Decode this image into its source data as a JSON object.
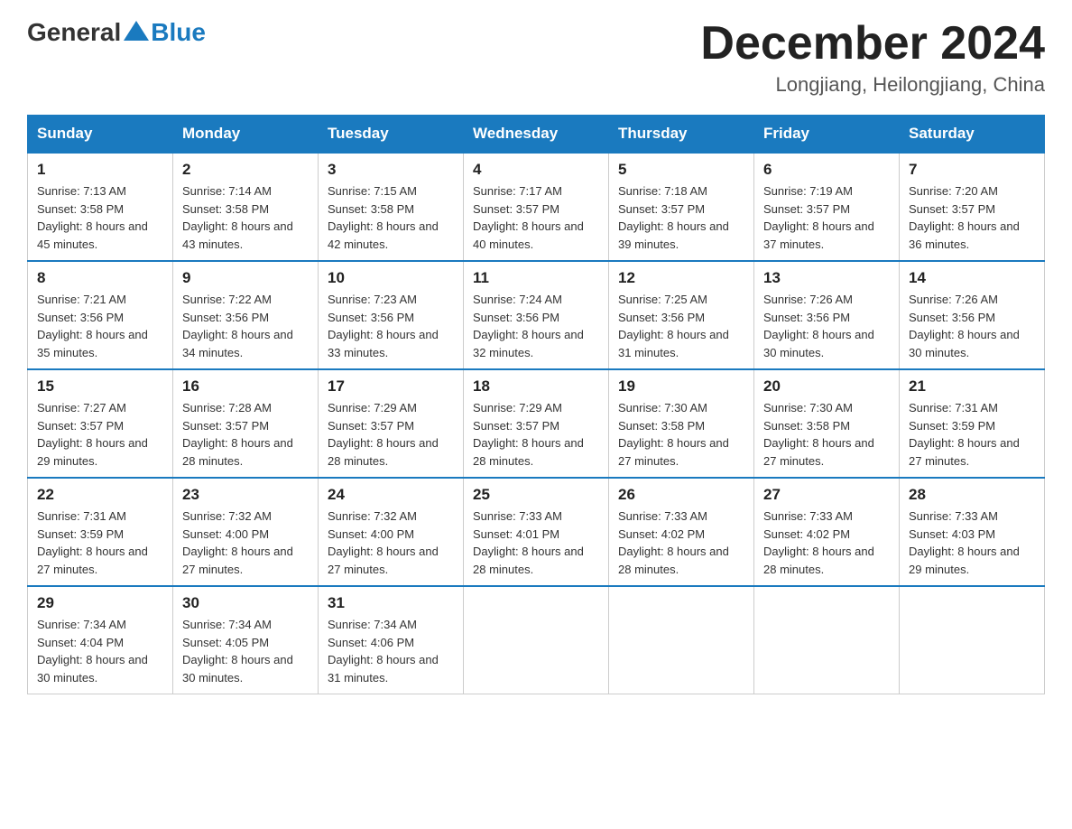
{
  "header": {
    "logo_general": "General",
    "logo_blue": "Blue",
    "month_title": "December 2024",
    "location": "Longjiang, Heilongjiang, China"
  },
  "weekdays": [
    "Sunday",
    "Monday",
    "Tuesday",
    "Wednesday",
    "Thursday",
    "Friday",
    "Saturday"
  ],
  "weeks": [
    [
      {
        "day": "1",
        "sunrise": "7:13 AM",
        "sunset": "3:58 PM",
        "daylight": "8 hours and 45 minutes."
      },
      {
        "day": "2",
        "sunrise": "7:14 AM",
        "sunset": "3:58 PM",
        "daylight": "8 hours and 43 minutes."
      },
      {
        "day": "3",
        "sunrise": "7:15 AM",
        "sunset": "3:58 PM",
        "daylight": "8 hours and 42 minutes."
      },
      {
        "day": "4",
        "sunrise": "7:17 AM",
        "sunset": "3:57 PM",
        "daylight": "8 hours and 40 minutes."
      },
      {
        "day": "5",
        "sunrise": "7:18 AM",
        "sunset": "3:57 PM",
        "daylight": "8 hours and 39 minutes."
      },
      {
        "day": "6",
        "sunrise": "7:19 AM",
        "sunset": "3:57 PM",
        "daylight": "8 hours and 37 minutes."
      },
      {
        "day": "7",
        "sunrise": "7:20 AM",
        "sunset": "3:57 PM",
        "daylight": "8 hours and 36 minutes."
      }
    ],
    [
      {
        "day": "8",
        "sunrise": "7:21 AM",
        "sunset": "3:56 PM",
        "daylight": "8 hours and 35 minutes."
      },
      {
        "day": "9",
        "sunrise": "7:22 AM",
        "sunset": "3:56 PM",
        "daylight": "8 hours and 34 minutes."
      },
      {
        "day": "10",
        "sunrise": "7:23 AM",
        "sunset": "3:56 PM",
        "daylight": "8 hours and 33 minutes."
      },
      {
        "day": "11",
        "sunrise": "7:24 AM",
        "sunset": "3:56 PM",
        "daylight": "8 hours and 32 minutes."
      },
      {
        "day": "12",
        "sunrise": "7:25 AM",
        "sunset": "3:56 PM",
        "daylight": "8 hours and 31 minutes."
      },
      {
        "day": "13",
        "sunrise": "7:26 AM",
        "sunset": "3:56 PM",
        "daylight": "8 hours and 30 minutes."
      },
      {
        "day": "14",
        "sunrise": "7:26 AM",
        "sunset": "3:56 PM",
        "daylight": "8 hours and 30 minutes."
      }
    ],
    [
      {
        "day": "15",
        "sunrise": "7:27 AM",
        "sunset": "3:57 PM",
        "daylight": "8 hours and 29 minutes."
      },
      {
        "day": "16",
        "sunrise": "7:28 AM",
        "sunset": "3:57 PM",
        "daylight": "8 hours and 28 minutes."
      },
      {
        "day": "17",
        "sunrise": "7:29 AM",
        "sunset": "3:57 PM",
        "daylight": "8 hours and 28 minutes."
      },
      {
        "day": "18",
        "sunrise": "7:29 AM",
        "sunset": "3:57 PM",
        "daylight": "8 hours and 28 minutes."
      },
      {
        "day": "19",
        "sunrise": "7:30 AM",
        "sunset": "3:58 PM",
        "daylight": "8 hours and 27 minutes."
      },
      {
        "day": "20",
        "sunrise": "7:30 AM",
        "sunset": "3:58 PM",
        "daylight": "8 hours and 27 minutes."
      },
      {
        "day": "21",
        "sunrise": "7:31 AM",
        "sunset": "3:59 PM",
        "daylight": "8 hours and 27 minutes."
      }
    ],
    [
      {
        "day": "22",
        "sunrise": "7:31 AM",
        "sunset": "3:59 PM",
        "daylight": "8 hours and 27 minutes."
      },
      {
        "day": "23",
        "sunrise": "7:32 AM",
        "sunset": "4:00 PM",
        "daylight": "8 hours and 27 minutes."
      },
      {
        "day": "24",
        "sunrise": "7:32 AM",
        "sunset": "4:00 PM",
        "daylight": "8 hours and 27 minutes."
      },
      {
        "day": "25",
        "sunrise": "7:33 AM",
        "sunset": "4:01 PM",
        "daylight": "8 hours and 28 minutes."
      },
      {
        "day": "26",
        "sunrise": "7:33 AM",
        "sunset": "4:02 PM",
        "daylight": "8 hours and 28 minutes."
      },
      {
        "day": "27",
        "sunrise": "7:33 AM",
        "sunset": "4:02 PM",
        "daylight": "8 hours and 28 minutes."
      },
      {
        "day": "28",
        "sunrise": "7:33 AM",
        "sunset": "4:03 PM",
        "daylight": "8 hours and 29 minutes."
      }
    ],
    [
      {
        "day": "29",
        "sunrise": "7:34 AM",
        "sunset": "4:04 PM",
        "daylight": "8 hours and 30 minutes."
      },
      {
        "day": "30",
        "sunrise": "7:34 AM",
        "sunset": "4:05 PM",
        "daylight": "8 hours and 30 minutes."
      },
      {
        "day": "31",
        "sunrise": "7:34 AM",
        "sunset": "4:06 PM",
        "daylight": "8 hours and 31 minutes."
      },
      null,
      null,
      null,
      null
    ]
  ],
  "labels": {
    "sunrise_prefix": "Sunrise: ",
    "sunset_prefix": "Sunset: ",
    "daylight_prefix": "Daylight: "
  }
}
